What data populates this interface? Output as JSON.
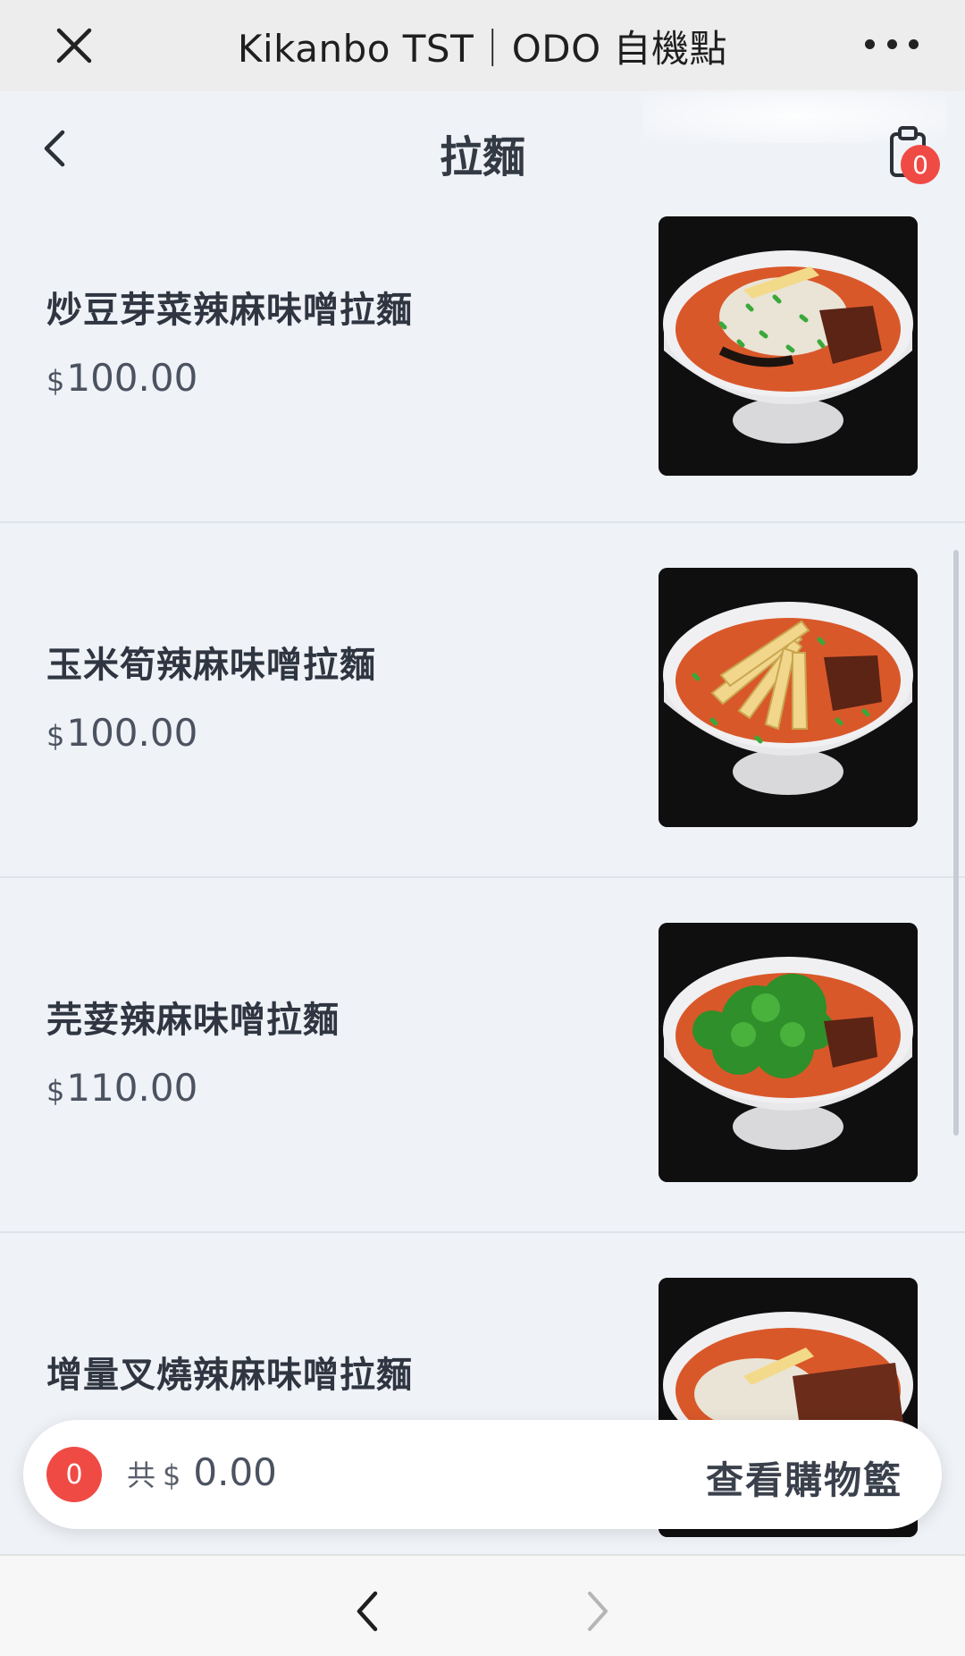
{
  "app": {
    "title": "Kikanbo TST｜ODO 自機點"
  },
  "header": {
    "title": "拉麵",
    "cart_count": "0"
  },
  "menu": {
    "items": [
      {
        "name": "炒豆芽菜辣麻味噌拉麵",
        "currency": "$",
        "price": "100.00",
        "topping": "bean-sprouts"
      },
      {
        "name": "玉米筍辣麻味噌拉麵",
        "currency": "$",
        "price": "100.00",
        "topping": "baby-corn"
      },
      {
        "name": "芫荽辣麻味噌拉麵",
        "currency": "$",
        "price": "110.00",
        "topping": "coriander"
      },
      {
        "name": "增量叉燒辣麻味噌拉麵",
        "topping": "extra-chashu"
      }
    ]
  },
  "cart_bar": {
    "count": "0",
    "total_label": "共",
    "currency": "$",
    "total": "0.00",
    "view_cart_label": "查看購物籃"
  },
  "colors": {
    "accent_red": "#f04a45",
    "page_bg": "#eff2f7"
  }
}
